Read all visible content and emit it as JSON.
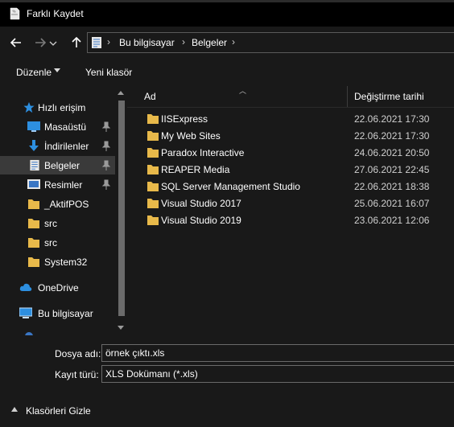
{
  "window": {
    "title": "Farklı Kaydet",
    "icon": "save-as-app-icon"
  },
  "nav": {
    "back_icon": "arrow-left-icon",
    "forward_icon": "arrow-right-icon",
    "up_icon": "arrow-up-icon",
    "breadcrumb": [
      "Bu bilgisayar",
      "Belgeler"
    ],
    "separator": "›"
  },
  "toolbar": {
    "organize_label": "Düzenle",
    "new_folder_label": "Yeni klasör"
  },
  "sidebar": {
    "items": [
      {
        "label": "Hızlı erişim",
        "icon": "star-icon",
        "pinned": false
      },
      {
        "label": "Masaüstü",
        "icon": "desktop-icon",
        "pinned": true
      },
      {
        "label": "İndirilenler",
        "icon": "download-icon",
        "pinned": true
      },
      {
        "label": "Belgeler",
        "icon": "documents-icon",
        "pinned": true,
        "selected": true
      },
      {
        "label": "Resimler",
        "icon": "pictures-icon",
        "pinned": true
      },
      {
        "label": "_AktifPOS",
        "icon": "folder-icon",
        "pinned": false
      },
      {
        "label": "src",
        "icon": "folder-icon",
        "pinned": false
      },
      {
        "label": "src",
        "icon": "folder-icon",
        "pinned": false
      },
      {
        "label": "System32",
        "icon": "folder-icon",
        "pinned": false
      },
      {
        "label": "OneDrive",
        "icon": "cloud-icon",
        "pinned": false
      },
      {
        "label": "Bu bilgisayar",
        "icon": "computer-icon",
        "pinned": false
      }
    ]
  },
  "files": {
    "columns": [
      "Ad",
      "Değiştirme tarihi"
    ],
    "rows": [
      {
        "name": "IISExpress",
        "modified": "22.06.2021 17:30"
      },
      {
        "name": "My Web Sites",
        "modified": "22.06.2021 17:30"
      },
      {
        "name": "Paradox Interactive",
        "modified": "24.06.2021 20:50"
      },
      {
        "name": "REAPER Media",
        "modified": "27.06.2021 22:45"
      },
      {
        "name": "SQL Server Management Studio",
        "modified": "22.06.2021 18:38"
      },
      {
        "name": "Visual Studio 2017",
        "modified": "25.06.2021 16:07"
      },
      {
        "name": "Visual Studio 2019",
        "modified": "23.06.2021 12:06"
      }
    ]
  },
  "save": {
    "filename_label": "Dosya adı:",
    "filename_value": "örnek çıktı.xls",
    "filetype_label": "Kayıt türü:",
    "filetype_value": "XLS Dokümanı (*.xls)",
    "hide_folders_label": "Klasörleri Gizle"
  },
  "colors": {
    "folder": "#e8b94a",
    "accent": "#2d8fe0",
    "background": "#191919"
  }
}
